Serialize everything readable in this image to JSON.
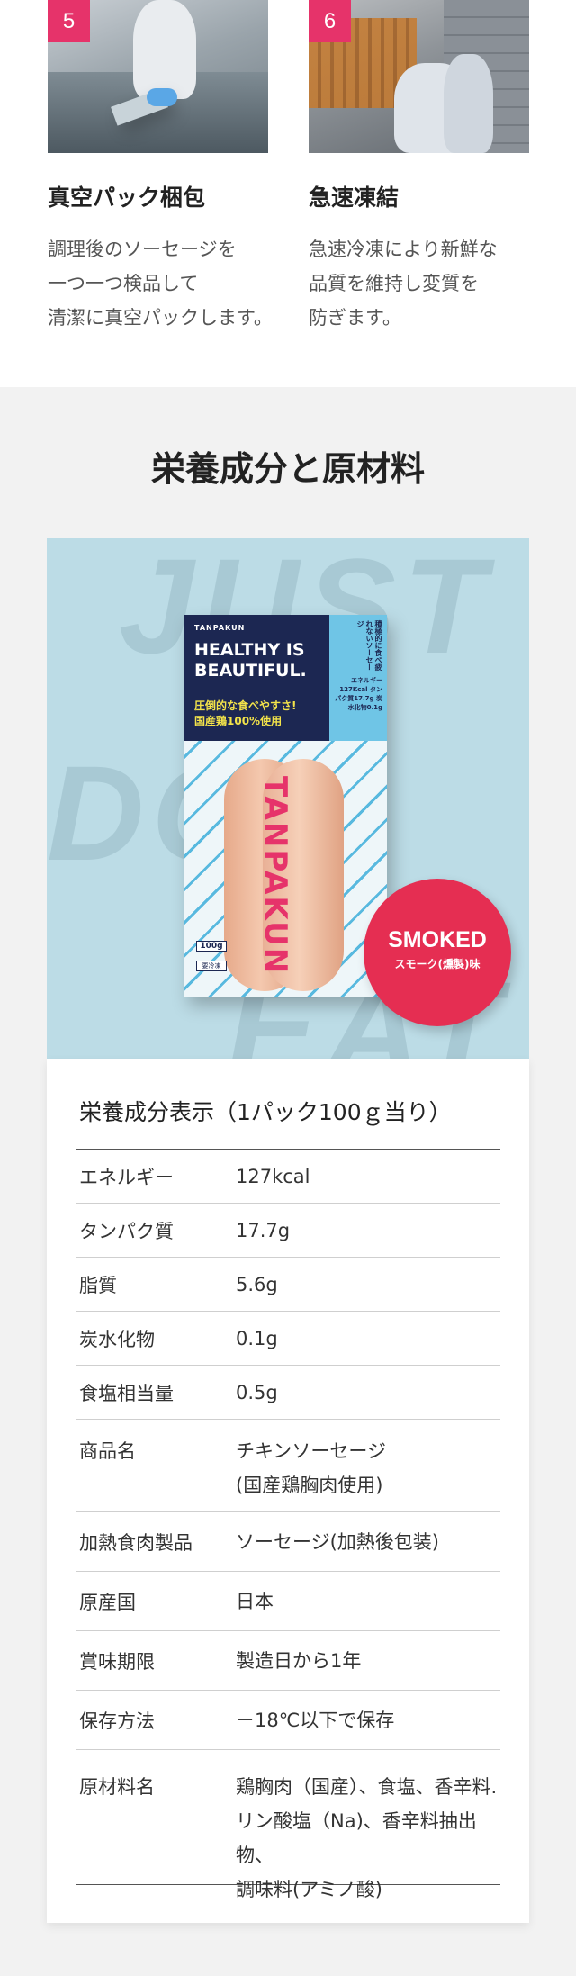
{
  "steps": [
    {
      "number": "5",
      "title": "真空パック梱包",
      "desc": [
        "調理後のソーセージを",
        "一つ一つ検品して",
        "清潔に真空パックします。"
      ]
    },
    {
      "number": "6",
      "title": "急速凍結",
      "desc": [
        "急速冷凍により新鮮な",
        "品質を維持し変質を",
        "防ぎます。"
      ]
    }
  ],
  "nutrition": {
    "section_title": "栄養成分と原材料",
    "package": {
      "brand": "TANPAKUN",
      "headline_1": "HEALTHY IS",
      "headline_2": "BEAUTIFUL.",
      "sub_1": "圧倒的な食べやすさ!",
      "sub_2": "国産鶏100%使用",
      "side_text": "積極的に食べ疲れないソーセージ",
      "side_kcal": "エネルギー127Kcal タンパク質17.7g 炭水化物0.1g",
      "vertical_name": "TANPAKUN",
      "weight": "100g",
      "frozen": "要冷凍",
      "smoked_big": "SMOKED",
      "smoked_small": "スモーク(燻製)味"
    },
    "table_title": "栄養成分表示（1パック100ｇ当り）",
    "rows": [
      {
        "key": "エネルギー",
        "value": "127kcal"
      },
      {
        "key": "タンパク質",
        "value": "17.7g"
      },
      {
        "key": "脂質",
        "value": "5.6g"
      },
      {
        "key": "炭水化物",
        "value": "0.1g"
      },
      {
        "key": "食塩相当量",
        "value": "0.5g"
      },
      {
        "key": "商品名",
        "value_lines": [
          "チキンソーセージ",
          "(国産鶏胸肉使用)"
        ]
      },
      {
        "key": "加熱食肉製品",
        "value": "ソーセージ(加熱後包装)"
      },
      {
        "key": "原産国",
        "value": "日本"
      },
      {
        "key": "賞味期限",
        "value": "製造日から1年"
      },
      {
        "key": "保存方法",
        "value": "－18℃以下で保存"
      },
      {
        "key": "原材料名",
        "value_lines": [
          "鶏胸肉（国産）、食塩、香辛料.",
          "リン酸塩（Na)、香辛料抽出物、",
          "調味料(アミノ酸)"
        ]
      }
    ]
  }
}
